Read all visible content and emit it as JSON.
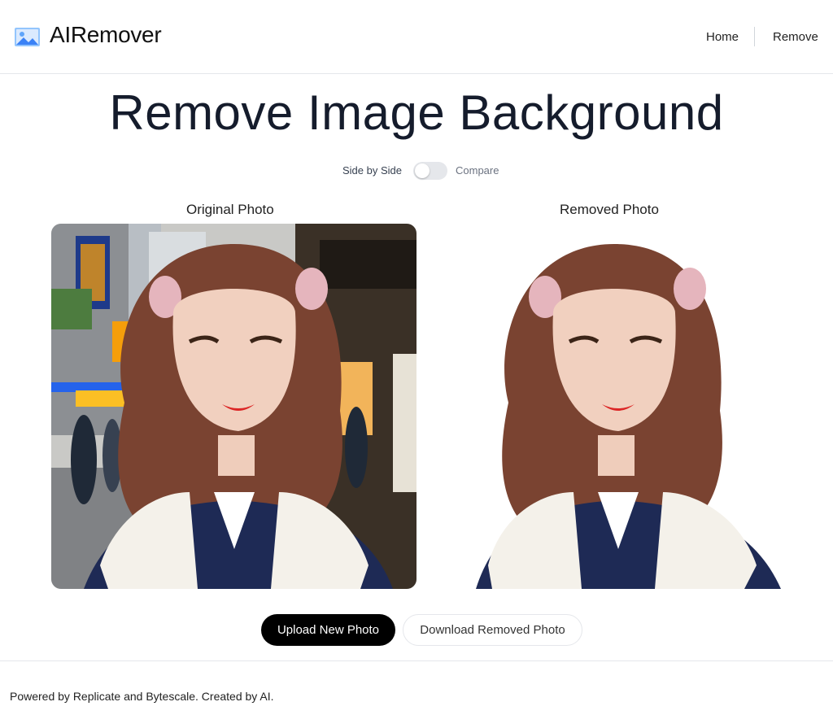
{
  "header": {
    "brand": "AIRemover",
    "logo_icon": "image-icon",
    "nav": {
      "home": "Home",
      "remove": "Remove"
    }
  },
  "main": {
    "title": "Remove Image Background",
    "toggle": {
      "left_label": "Side by Side",
      "right_label": "Compare",
      "checked": false
    },
    "original_caption": "Original Photo",
    "removed_caption": "Removed Photo",
    "upload_button": "Upload New Photo",
    "download_button": "Download Removed Photo"
  },
  "footer": {
    "text": "Powered by Replicate and Bytescale. Created by AI."
  },
  "colors": {
    "primary_button": "#000000",
    "title": "#151c2c",
    "border": "#e5e7eb",
    "logo": "#60a5fa"
  }
}
